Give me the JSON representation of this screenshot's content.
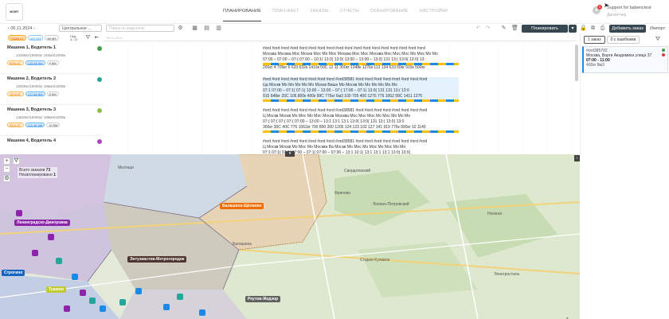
{
  "header": {
    "logo_text": "MOIRT",
    "nav": [
      "ПЛАНИРОВАНИЕ",
      "ПЛАН-ФАКТ",
      "ЗАКАЗЫ",
      "ОТЧЕТЫ",
      "СКАНИРОВАНИЕ",
      "НАСТРОЙКИ"
    ],
    "user_name": "Support for babenctest",
    "user_role": "Диспетчер",
    "notif_count": "0"
  },
  "toolbar": {
    "date": "‹  06.11.2024  ›",
    "depot": "Центральное ...",
    "search_placeholder": "Поиск по водителю",
    "plan_label": "Планировать",
    "add_order_label": "Добавить заказ",
    "import_label": "Импорт"
  },
  "chips": [
    "75686 КГ",
    "403 МЗ",
    "98 МЗ"
  ],
  "week": {
    "line1": "Нед",
    "line2": "4 / 11"
  },
  "timeline_label": "06.11.2024",
  "drivers": [
    {
      "name": "Машина 1, Водитель 1",
      "stat": "14458кг/15000кг  194м3/1000м",
      "tag1": "5956 КГ",
      "tag2": "133.69 КМ",
      "tag3": "9 КМ",
      "dot": "#43a047"
    },
    {
      "name": "Машина 2, Водитель 2",
      "stat": "13928кг/15000кг  186м3/1000м",
      "tag1": "4403 КГ",
      "tag2": "107.88 КМ",
      "tag3": "8 КМ",
      "dot": "#26a69a"
    },
    {
      "name": "Машина 3, Водитель 3",
      "stat": "14823кг/15000кг  198м3/1000м",
      "tag1": "5544 КГ",
      "tag2": "115.38 КМ",
      "tag3": "10 КМ",
      "dot": "#8bc34a"
    },
    {
      "name": "Машина 4, Водитель 4",
      "stat": "",
      "tag1": "",
      "tag2": "",
      "tag3": "",
      "dot": "#ab47bc"
    }
  ],
  "route_rows": [
    {
      "ids": "#ord #ord #ord #ord #ord #ord #ord #ord #ord #ord #ord #ord #ord #ord #ord #ord #ord #ord",
      "city": "Москва Москва Мос Москв Мос Мо Мос Москва Мос Мос Москва Мос Мос Мос Мо Мос Мо Мо",
      "time": "07:00 – 07:00 – 07:( 07:00 – 10:1( 13:0( 13:0( 13:00 – 13:00 – 13:0( 131 13:( 13:0( 13:0( 13:",
      "w": "200кг 4 705кг 6 633 632к 1419к 50С 12 11 300кг 1348к 1276к 113 134 633 50кг 919к 500кг"
    },
    {
      "ids": "#ord #ord #ord #ord #ord #ord #ord #ord #ord38581 #ord #ord #ord #ord #ord #ord #ord #ord",
      "city": "Ца Москв Мо Мо Мо Мо Мо Москв Вишн Мо Москв Мо Мо Мо Мо Мо Мо",
      "time": "07:1 07:00 – 07:1( 07:1( 13:00 – 13:00 – 07:( 17:00 – 07:1( 13:0( 131 131 13:( 13:0",
      "w": "915 648кг 20С 106 800к 400к 99С 776кг 6м3 100 705 400 1276 776 1062 99С 1411 1275"
    },
    {
      "ids": "#ord #ord #ord #ord #ord #ord #ord #ord #ord38581 #ord #ord #ord #ord #ord #ord #ord #ord",
      "city": "Ц Москв Москв Мо Мос Мо Мос Москв Москва Мос Мос Мос Мо Мос Мо Мо Мо",
      "time": "07:( 07:( 07:( 07:( 07:00 – 13:00 – 13:1 13:1 13:1 13:0( 13:0( 131 13:( 13:0( 13:0",
      "w": "300кг 30С 40С 776 1062кг 700 800 200 1205 124 123 102 127 141 919 776к 990кг 10 1140"
    },
    {
      "ids": "#ord #ord #ord #ord #ord #ord #ord #ord #ord38581 #ord #ord #ord #ord #ord #ord #ord #ord",
      "city": "Ц Москв Москв Мо Мос Мо Москва Ва Москв Мо Мос Мо Мос Мо Мос Мо Мо",
      "time": "07:1 07:1( 07:1( 07:00 – 07:1( 07:00 – 07:00 – 13:1 10:1( 13:1 13:1 13:1 13:0( 13:0(",
      "w": ""
    }
  ],
  "right_panel": {
    "tab1": "1 заказ",
    "tab2": "0 с ошибками",
    "order_id": "#ord385792",
    "order_addr": "Москва, Варги Академика улица 37",
    "order_time": "07:00 - 11:00",
    "order_weight": "400кг 8м3"
  },
  "map": {
    "total_label": "Всего заказов",
    "total_value": "73",
    "unplanned_label": "Незапланировано",
    "unplanned_value": "1",
    "zones": [
      {
        "name": "Ленинградско-Дмитровка",
        "color": "#8e24aa"
      },
      {
        "name": "Балашиха-Щёлково",
        "color": "#ef6c00"
      },
      {
        "name": "Энтузиастов-Метрогородок",
        "color": "#4e342e"
      },
      {
        "name": "Реутов-Жодзор",
        "color": "#616161"
      },
      {
        "name": "Строгино",
        "color": "#1565c0"
      },
      {
        "name": "Тушино",
        "color": "#c0ca33"
      }
    ],
    "towns": [
      "Мытищи",
      "Свердловский",
      "Фряново",
      "Лосино-Петровский",
      "Балашиха",
      "Старая Купавна",
      "Ногинск",
      "Электросталь"
    ]
  }
}
